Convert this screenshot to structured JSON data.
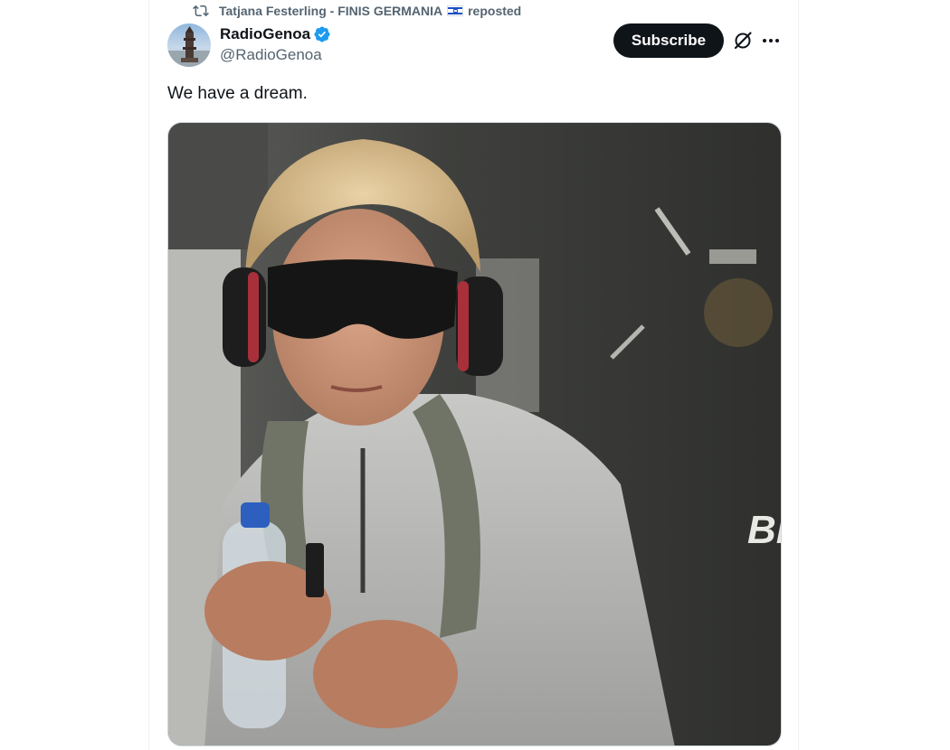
{
  "repost": {
    "reposter_name": "Tatjana Festerling - FINIS GERMANIA",
    "flag_icon": "israel-flag-icon",
    "suffix": "reposted"
  },
  "author": {
    "display_name": "RadioGenoa",
    "handle": "@RadioGenoa",
    "verified": true,
    "verified_color": "#1d9bf0"
  },
  "actions": {
    "subscribe_label": "Subscribe",
    "grok_icon": "grok-icon",
    "more_icon": "more-icon"
  },
  "tweet": {
    "text": "We have a dream."
  },
  "media": {
    "type": "photo"
  },
  "colors": {
    "text_primary": "#0f1419",
    "text_secondary": "#536471",
    "button_bg": "#0f1419",
    "border": "#eff3f4"
  }
}
